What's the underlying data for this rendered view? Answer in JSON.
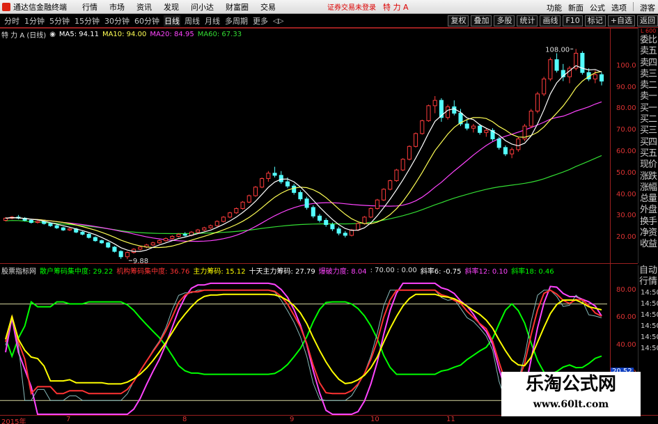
{
  "menubar": {
    "app_title": "通达信金融终端",
    "items": [
      "行情",
      "市场",
      "资讯",
      "发现",
      "问小达",
      "财富圈",
      "交易"
    ],
    "login_status": "证券交易未登录",
    "stock_title": "特 力 A",
    "right_links": [
      "功能",
      "新面",
      "公式",
      "选项"
    ],
    "guest": "游客"
  },
  "periodbar": {
    "tabs": [
      "分时",
      "1分钟",
      "5分钟",
      "15分钟",
      "30分钟",
      "60分钟",
      "日线",
      "周线",
      "月线",
      "多周期",
      "更多"
    ],
    "active_tab": "日线",
    "arrows": "◁▷",
    "tools": [
      "复权",
      "叠加",
      "多股",
      "统计",
      "画线",
      "F10",
      "标记",
      "+自选",
      "返回"
    ]
  },
  "main_info": {
    "title": "特 力 A (日线)",
    "ma5_label": "MA5: 94.11",
    "ma10_label": "MA10: 94.00",
    "ma20_label": "MA20: 84.95",
    "ma60_label": "MA60: 67.33",
    "colors": {
      "ma5": "#ffffff",
      "ma10": "#ffff55",
      "ma20": "#ff44ff",
      "ma60": "#33dd33"
    }
  },
  "annotations": {
    "high": "108.00",
    "low": "9.88"
  },
  "price_axis": [
    "100.0",
    "90.00",
    "80.00",
    "70.00",
    "60.00",
    "50.00",
    "40.00",
    "30.00",
    "20.00"
  ],
  "side_panel": {
    "head": "L 600",
    "items": [
      "委比",
      "卖五",
      "卖四",
      "卖三",
      "卖二",
      "卖一",
      "买一",
      "买二",
      "买三",
      "买四",
      "买五",
      "现价",
      "涨跌",
      "涨幅",
      "总量",
      "外盘",
      "换手",
      "净资",
      "收益"
    ]
  },
  "indicator_info": {
    "title": "股票指标网",
    "retail": "散户筹码集中度: 29.22",
    "institution": "机构筹码集中度: 36.76",
    "main": "主力筹码: 15.12",
    "ten_day": "十天主力筹码: 27.79",
    "explode": "爆破力度: 8.04",
    "values": ": 70.00 : 0.00",
    "slope6": "斜率6: -0.75",
    "slope12": "斜率12: 0.10",
    "slope18": "斜率18: 0.46",
    "colors": {
      "retail": "#00ff00",
      "institution": "#ff3333",
      "main": "#ffff00",
      "ten_day": "#ffffff",
      "explode": "#ff44ff",
      "slope18": "#00ff00"
    }
  },
  "ind_axis": [
    "80.00",
    "60.00",
    "40.00",
    "20.00"
  ],
  "ind_current": "20.52",
  "side_panel2": {
    "items": [
      "自动",
      "行情"
    ],
    "times": [
      "14:50",
      "14:50",
      "14:50",
      "14:50",
      "14:50",
      "14:50"
    ]
  },
  "date_axis": [
    "2015年",
    "7",
    "8",
    "9",
    "10",
    "11"
  ],
  "watermark": {
    "title": "乐淘公式网",
    "url": "www.60lt.com"
  },
  "chart_data": {
    "type": "candlestick",
    "y_range": [
      8,
      112
    ],
    "candles": [
      [
        28,
        29.5,
        27.5,
        29
      ],
      [
        29,
        30,
        28.5,
        29.5
      ],
      [
        29.5,
        30.5,
        28.5,
        29
      ],
      [
        29,
        29.5,
        27.5,
        28
      ],
      [
        28,
        28.5,
        26.5,
        27
      ],
      [
        27,
        28,
        26.5,
        27.5
      ],
      [
        27.5,
        28,
        26,
        26.5
      ],
      [
        26.5,
        27,
        25,
        25.5
      ],
      [
        25.5,
        26,
        24,
        24.5
      ],
      [
        24.5,
        25,
        23,
        23.5
      ],
      [
        23.5,
        24.5,
        23,
        24
      ],
      [
        24,
        24.5,
        22,
        22.5
      ],
      [
        22.5,
        23,
        21,
        21.5
      ],
      [
        21.5,
        22,
        19.5,
        20
      ],
      [
        20,
        20.5,
        18,
        18.5
      ],
      [
        18.5,
        19,
        17,
        17.5
      ],
      [
        17.5,
        18,
        15,
        15.5
      ],
      [
        15.5,
        16,
        13,
        13.5
      ],
      [
        13.5,
        14,
        10,
        11
      ],
      [
        11,
        13.5,
        9.88,
        13
      ],
      [
        13,
        15,
        12.5,
        14.5
      ],
      [
        14.5,
        16,
        14,
        15.5
      ],
      [
        15.5,
        17,
        15,
        16.5
      ],
      [
        16.5,
        18,
        16,
        17.5
      ],
      [
        17.5,
        19,
        17,
        18.5
      ],
      [
        18.5,
        20,
        18,
        19.5
      ],
      [
        19.5,
        21,
        19,
        20.5
      ],
      [
        20.5,
        22,
        20,
        21.5
      ],
      [
        21.5,
        22.5,
        20.5,
        21
      ],
      [
        21,
        23,
        20.5,
        22.5
      ],
      [
        22.5,
        24,
        22,
        23.5
      ],
      [
        23.5,
        25,
        23,
        24.5
      ],
      [
        24.5,
        26,
        24,
        25.5
      ],
      [
        25.5,
        28,
        25,
        27.5
      ],
      [
        27.5,
        30,
        27,
        29.5
      ],
      [
        29.5,
        32,
        29,
        31.5
      ],
      [
        31.5,
        34,
        31,
        33.5
      ],
      [
        33.5,
        37,
        33,
        36.5
      ],
      [
        36.5,
        40,
        36,
        39.5
      ],
      [
        39.5,
        44,
        39,
        43.5
      ],
      [
        43.5,
        48,
        43,
        47.5
      ],
      [
        47.5,
        51,
        46,
        50
      ],
      [
        50,
        53,
        48,
        49
      ],
      [
        49,
        51,
        45,
        46
      ],
      [
        46,
        48,
        43,
        44
      ],
      [
        44,
        45,
        40,
        41
      ],
      [
        41,
        42,
        37,
        38
      ],
      [
        38,
        39,
        33,
        34
      ],
      [
        34,
        35,
        29,
        30
      ],
      [
        30,
        31,
        27,
        28
      ],
      [
        28,
        29,
        25,
        26
      ],
      [
        26,
        27,
        23,
        24
      ],
      [
        24,
        25,
        21,
        22
      ],
      [
        22,
        23,
        20,
        21
      ],
      [
        21,
        24,
        20.5,
        23.5
      ],
      [
        23.5,
        27,
        23,
        26.5
      ],
      [
        26.5,
        30,
        26,
        29.5
      ],
      [
        29.5,
        34,
        29,
        33.5
      ],
      [
        33.5,
        38,
        33,
        37.5
      ],
      [
        37.5,
        43,
        37,
        42.5
      ],
      [
        42.5,
        47,
        42,
        46.5
      ],
      [
        46.5,
        52,
        46,
        51.5
      ],
      [
        51.5,
        57,
        51,
        56.5
      ],
      [
        56.5,
        63,
        56,
        62.5
      ],
      [
        62.5,
        69,
        62,
        68.5
      ],
      [
        68.5,
        75,
        68,
        74.5
      ],
      [
        74.5,
        82,
        74,
        81.5
      ],
      [
        81.5,
        86,
        78,
        84
      ],
      [
        84,
        85,
        74,
        76
      ],
      [
        76,
        82,
        75,
        81
      ],
      [
        81,
        84,
        77,
        78
      ],
      [
        78,
        80,
        72,
        73
      ],
      [
        73,
        75,
        70,
        71
      ],
      [
        71,
        73,
        69,
        72
      ],
      [
        72,
        73,
        68,
        69
      ],
      [
        69,
        71,
        67,
        70
      ],
      [
        70,
        71,
        65,
        66
      ],
      [
        66,
        67,
        61,
        62
      ],
      [
        62,
        63,
        58,
        59
      ],
      [
        59,
        62,
        57,
        61
      ],
      [
        61,
        67,
        60,
        66
      ],
      [
        66,
        73,
        65,
        72
      ],
      [
        72,
        80,
        71,
        79
      ],
      [
        79,
        88,
        78,
        87
      ],
      [
        87,
        95,
        86,
        94
      ],
      [
        94,
        104,
        93,
        103
      ],
      [
        103,
        106,
        97,
        98
      ],
      [
        98,
        101,
        93,
        95
      ],
      [
        95,
        100,
        92,
        99
      ],
      [
        99,
        108,
        98,
        106
      ],
      [
        106,
        107,
        96,
        97
      ],
      [
        97,
        99,
        93,
        94
      ],
      [
        94,
        98,
        92,
        96
      ],
      [
        96,
        97,
        91,
        93
      ]
    ],
    "ma_series": [
      "MA5",
      "MA10",
      "MA20",
      "MA60"
    ],
    "indicator_series": [
      "散户筹码集中度",
      "机构筹码集中度",
      "主力筹码",
      "十天主力筹码",
      "爆破力度"
    ],
    "indicator_y_range": [
      -10,
      90
    ],
    "indicator_levels": [
      70,
      0
    ]
  }
}
